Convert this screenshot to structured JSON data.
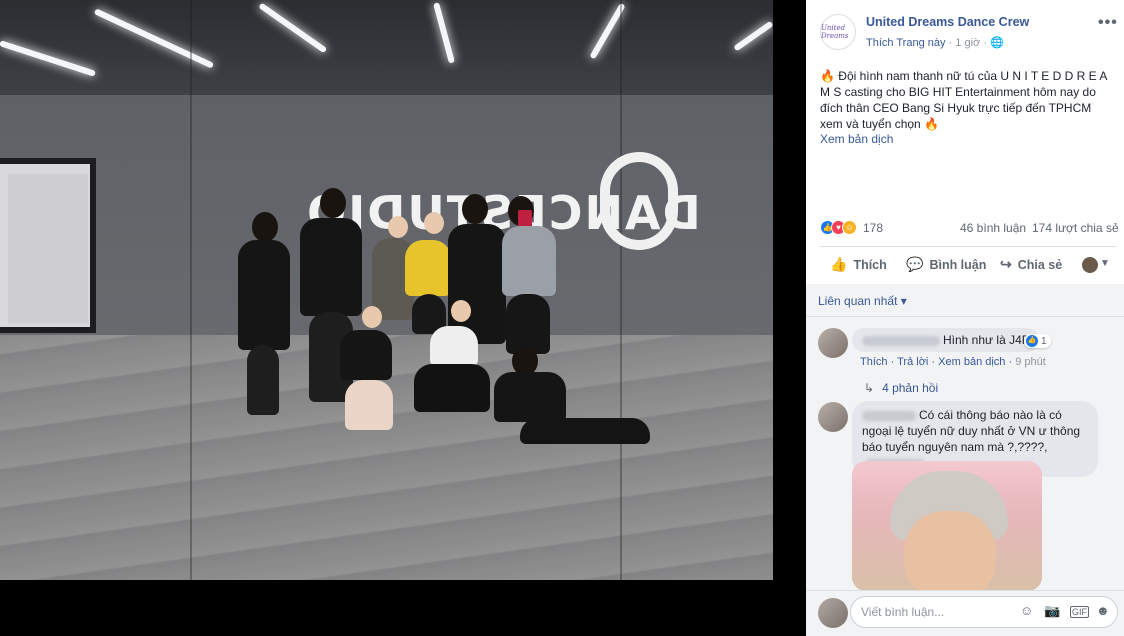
{
  "post": {
    "page_name": "United Dreams Dance Crew",
    "avatar_text": "United Dreams",
    "like_page": "Thích Trang này",
    "time": "1 giờ",
    "privacy_icon": "globe-icon",
    "more_label": "•••",
    "text": "🔥 Đội hình nam thanh nữ tú của U N I T E D D R E A M S casting cho BIG HIT Entertainment hôm nay do đích thân CEO Bang Si Hyuk trực tiếp đến TPHCM xem và tuyển chọn 🔥",
    "see_translation": "Xem bản dịch",
    "studio_logo_text": "DANCESTUDIO"
  },
  "stats": {
    "reaction_count": "178",
    "comments": "46 bình luận",
    "shares": "174 lượt chia sẻ"
  },
  "actions": {
    "like": "Thích",
    "comment": "Bình luận",
    "share": "Chia sẻ"
  },
  "comments_section": {
    "sort_label": "Liên quan nhất ▾",
    "comments": [
      {
        "text": "Hình như là J4F",
        "likes": "1",
        "actions": {
          "like": "Thích",
          "reply": "Trả lời",
          "translate": "Xem bản dịch",
          "time": "9 phút"
        },
        "replies": "4 phản hồi"
      },
      {
        "text": "Có cái thông báo nào là có ngoại lệ tuyển nữ duy nhất ở VN ư thông báo tuyển nguyên nam mà ?,????,"
      }
    ]
  },
  "composer": {
    "placeholder": "Viết bình luận..."
  },
  "colors": {
    "link": "#385898",
    "muted": "#90949c",
    "like_blue": "#1877f2",
    "love_red": "#f33e58"
  }
}
